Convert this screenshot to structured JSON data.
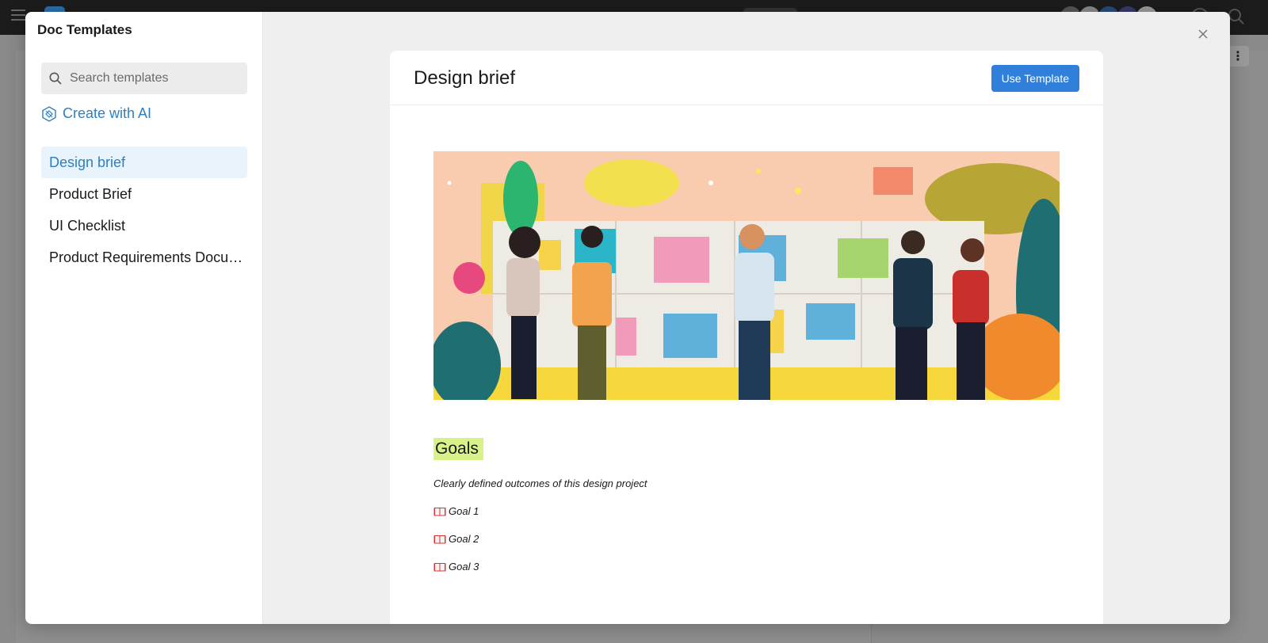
{
  "sidebar": {
    "title": "Doc Templates",
    "search_placeholder": "Search templates",
    "ai_label": "Create with AI",
    "templates": [
      {
        "label": "Design brief",
        "active": true
      },
      {
        "label": "Product Brief",
        "active": false
      },
      {
        "label": "UI Checklist",
        "active": false
      },
      {
        "label": "Product Requirements Document",
        "active": false
      }
    ]
  },
  "preview": {
    "title": "Design brief",
    "use_button": "Use Template",
    "goals_heading": "Goals",
    "goals_sub": "Clearly defined outcomes of this design project",
    "goals": [
      "Goal 1",
      "Goal 2",
      "Goal 3"
    ]
  },
  "colors": {
    "accent": "#2f7fbd",
    "button": "#2f7fdb",
    "active_bg": "#e8f3fc",
    "highlight": "#d8f28a"
  },
  "icons": {
    "search": "search-icon",
    "ai": "ai-sparkle-icon",
    "close": "close-icon",
    "goal": "book-icon"
  }
}
